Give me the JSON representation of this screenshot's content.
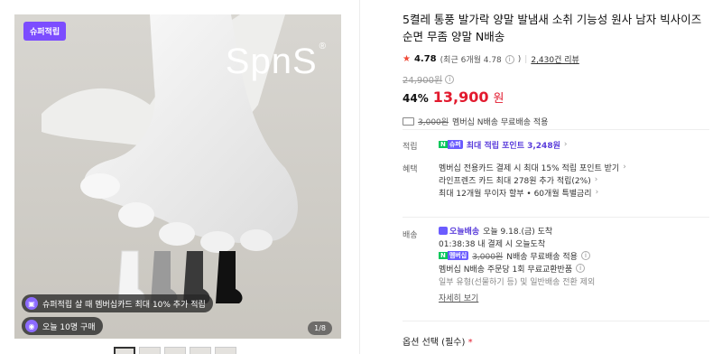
{
  "gallery": {
    "badge": "슈퍼적립",
    "brand": "SpnS",
    "brand_mark": "®",
    "promo1": "슈퍼적립 살 때 멤버십카드 최대 10% 추가 적립",
    "promo2": "오늘 10명 구매",
    "counter": "1/8",
    "thumb_count": 5
  },
  "product": {
    "title": "5켤레 통풍 발가락 양말 발냄새 소취 기능성 원사 남자 빅사이즈 순면 무좀 양말 N배송",
    "rating": "4.78",
    "rating_detail": "(최근 6개월 4.78",
    "reviews": "2,430건 리뷰",
    "original_price": "24,900원",
    "discount": "44%",
    "price": "13,900",
    "currency": "원",
    "shipping_old": "3,000원",
    "shipping_text": "멤버십 N배송 무료배송 적용"
  },
  "points": {
    "label": "적립",
    "badge_n": "N",
    "badge_m": "슈퍼",
    "text": "최대 적립 포인트 3,248원"
  },
  "benefits": {
    "label": "혜택",
    "items": [
      "멤버십 전용카드 결제 시 최대 15% 적립 포인트 받기",
      "라인프렌즈 카드 최대 278원 추가 적립(2%)",
      "최대 12개월 무이자 할부 • 60개월 특별금리"
    ]
  },
  "delivery": {
    "label": "배송",
    "badge": "오늘배송",
    "today": "오늘 9.18.(금) 도착",
    "countdown": "01:38:38  내 결제 시 오늘도착",
    "badge_n": "N",
    "badge_m": "멤버십",
    "free_old": "3,000원",
    "free_text": "N배송 무료배송 적용",
    "return_text": "멤버십 N배송 주문당 1회 무료교환반품",
    "note": "일부 유형(선물하기 등) 및 일반배송 전환 제외",
    "more": "자세히 보기"
  },
  "options": {
    "label": "옵션 선택",
    "required": "(필수)",
    "asterisk": "*"
  }
}
